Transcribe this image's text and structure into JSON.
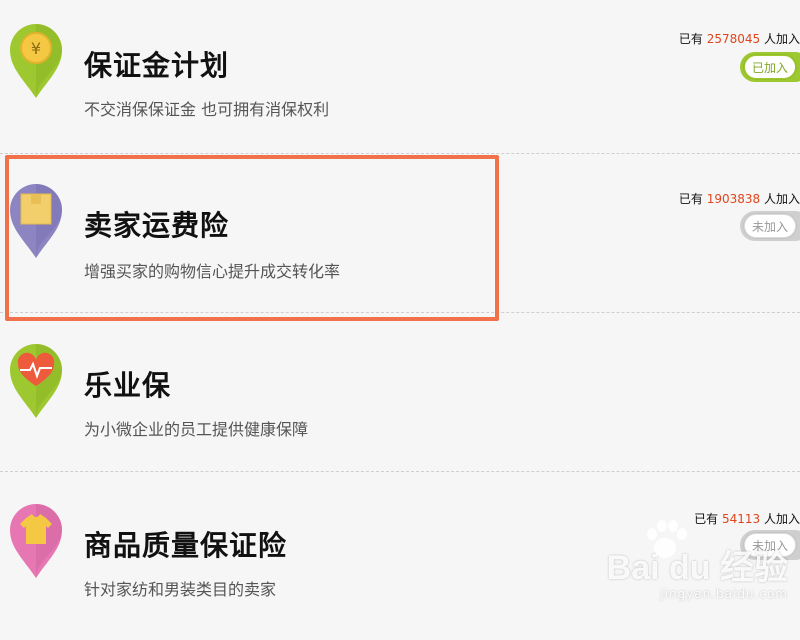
{
  "items": [
    {
      "title": "保证金计划",
      "description": "不交消保保证金 也可拥有消保权利",
      "count_prefix": "已有",
      "count": "2578045",
      "count_suffix": "人加入",
      "toggle_label": "已加入",
      "toggle_state": "on",
      "icon": "coin-yen-icon",
      "pin_color": "#9ec82f",
      "icon_color": "#f4c842"
    },
    {
      "title": "卖家运费险",
      "description": "增强买家的购物信心提升成交转化率",
      "count_prefix": "已有",
      "count": "1903838",
      "count_suffix": "人加入",
      "toggle_label": "未加入",
      "toggle_state": "off",
      "icon": "package-box-icon",
      "pin_color": "#8d85c2",
      "icon_color": "#f2cf6a"
    },
    {
      "title": "乐业保",
      "description": "为小微企业的员工提供健康保障",
      "count_prefix": "",
      "count": "",
      "count_suffix": "",
      "toggle_label": "",
      "toggle_state": "",
      "icon": "heart-pulse-icon",
      "pin_color": "#9ec82f",
      "icon_color": "#ee5b3c"
    },
    {
      "title": "商品质量保证险",
      "description": "针对家纺和男装类目的卖家",
      "count_prefix": "已有",
      "count": "54113",
      "count_suffix": "人加入",
      "toggle_label": "未加入",
      "toggle_state": "off",
      "icon": "tshirt-icon",
      "pin_color": "#e677b3",
      "icon_color": "#f4c842"
    }
  ],
  "colors": {
    "highlight": "#f0714a",
    "count_number": "#e0451d",
    "toggle_on": "#9ec82f"
  },
  "watermark": {
    "logo": "Bai du 经验",
    "url": "jingyan.baidu.com"
  }
}
